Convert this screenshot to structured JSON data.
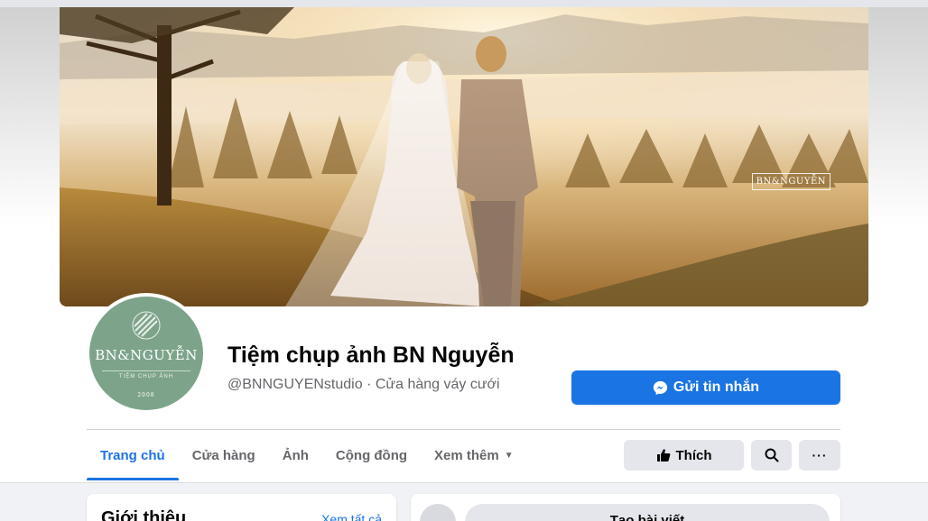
{
  "cover": {
    "watermark": "BN&NGUYỄN"
  },
  "avatar": {
    "name": "BN&NGUYỄN",
    "tagline": "TIỆM CHỤP ẢNH",
    "year": "2008"
  },
  "page": {
    "title": "Tiệm chụp ảnh BN Nguyễn",
    "subtitle": "@BNNGUYENstudio · Cửa hàng váy cưới"
  },
  "actions": {
    "message_label": "Gửi tin nhắn",
    "message_icon": "messenger-icon",
    "like_label": "Thích",
    "like_icon": "thumbs-up-icon",
    "search_icon": "search-icon",
    "more_label": "···"
  },
  "tabs": [
    {
      "label": "Trang chủ",
      "active": true
    },
    {
      "label": "Cửa hàng",
      "active": false
    },
    {
      "label": "Ảnh",
      "active": false
    },
    {
      "label": "Cộng đồng",
      "active": false
    },
    {
      "label": "Xem thêm",
      "active": false
    }
  ],
  "intro": {
    "title": "Giới thiệu",
    "see_all": "Xem tất cả"
  },
  "composer": {
    "label": "Tạo bài viết"
  },
  "colors": {
    "accent": "#1b74e4",
    "avatar_bg": "#7da48a",
    "button_gray": "#e4e6eb",
    "page_bg": "#f0f2f5"
  }
}
